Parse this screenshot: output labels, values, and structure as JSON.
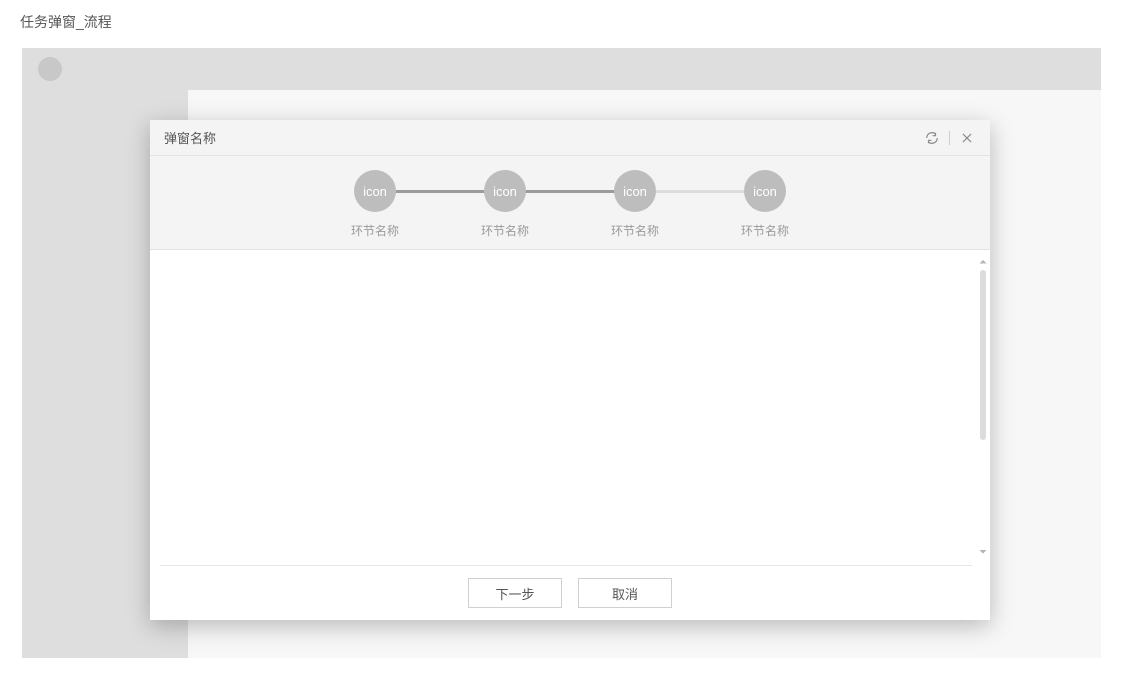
{
  "page": {
    "title": "任务弹窗_流程"
  },
  "modal": {
    "title": "弹窗名称",
    "steps": [
      {
        "icon": "icon",
        "label": "环节名称",
        "connector": "active"
      },
      {
        "icon": "icon",
        "label": "环节名称",
        "connector": "active"
      },
      {
        "icon": "icon",
        "label": "环节名称",
        "connector": "inactive"
      },
      {
        "icon": "icon",
        "label": "环节名称",
        "connector": "none"
      }
    ],
    "footer": {
      "next": "下一步",
      "cancel": "取消"
    }
  }
}
